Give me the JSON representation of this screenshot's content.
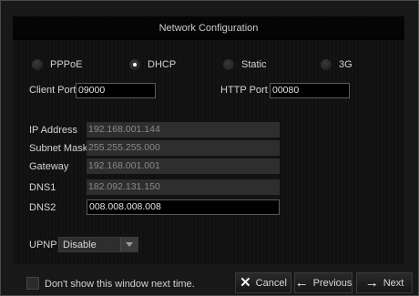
{
  "window": {
    "title": "Network Configuration"
  },
  "connection_type": {
    "options": [
      {
        "label": "PPPoE",
        "selected": false
      },
      {
        "label": "DHCP",
        "selected": true
      },
      {
        "label": "Static",
        "selected": false
      },
      {
        "label": "3G",
        "selected": false
      }
    ]
  },
  "ports": {
    "client_port_label": "Client Port",
    "client_port_value": "09000",
    "http_port_label": "HTTP Port",
    "http_port_value": "00080"
  },
  "network": {
    "ip_label": "IP Address",
    "ip_value": "192.168.001.144",
    "subnet_label": "Subnet Mask",
    "subnet_value": "255.255.255.000",
    "gateway_label": "Gateway",
    "gateway_value": "192.168.001.001",
    "dns1_label": "DNS1",
    "dns1_value": "182.092.131.150",
    "dns2_label": "DNS2",
    "dns2_value": "008.008.008.008"
  },
  "upnp": {
    "label": "UPNP",
    "value": "Disable"
  },
  "footer": {
    "dont_show_label": "Don't show this window next time.",
    "cancel_label": "Cancel",
    "previous_label": "Previous",
    "next_label": "Next"
  },
  "icons": {
    "cancel": "close-icon",
    "previous": "arrow-left-icon",
    "next": "arrow-right-icon"
  }
}
